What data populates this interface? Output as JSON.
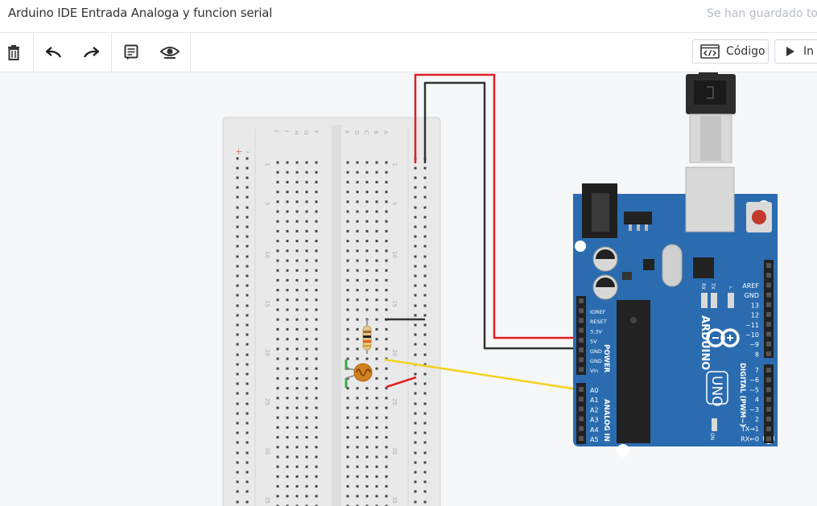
{
  "header": {
    "title": "Arduino IDE Entrada Analoga y funcion serial",
    "save_status": "Se han guardado to"
  },
  "toolbar": {
    "code_label": "Código",
    "sim_label": "In"
  },
  "board": {
    "brand": "ARDUINO",
    "model": "UNO",
    "power_label": "POWER",
    "analog_label": "ANALOG IN",
    "digital_label": "DIGITAL (PWM~)",
    "on_label": "ON",
    "l_label": "L",
    "tx_label": "TX",
    "rx_label": "RX",
    "power_pins": [
      "IOREF",
      "RESET",
      "3.3V",
      "5V",
      "GND",
      "GND",
      "Vin"
    ],
    "analog_pins": [
      "A0",
      "A1",
      "A2",
      "A3",
      "A4",
      "A5"
    ],
    "digital_top": [
      "AREF",
      "GND",
      "13",
      "12",
      "~11",
      "~10",
      "~9",
      "8"
    ],
    "digital_bottom": [
      "7",
      "~6",
      "~5",
      "4",
      "~3",
      "2",
      "TX→1",
      "RX←0"
    ]
  },
  "breadboard": {
    "left_letters": [
      "J",
      "I",
      "H",
      "G",
      "F"
    ],
    "right_letters": [
      "E",
      "D",
      "C",
      "B",
      "A"
    ],
    "row_numbers": [
      "1",
      "5",
      "10",
      "15",
      "20",
      "25",
      "30",
      "35"
    ]
  },
  "colors": {
    "board": "#2b6cb0",
    "wire_red": "#e02020",
    "wire_black": "#333333",
    "wire_yellow": "#f2d21b",
    "breadboard": "#e9e9e9"
  }
}
